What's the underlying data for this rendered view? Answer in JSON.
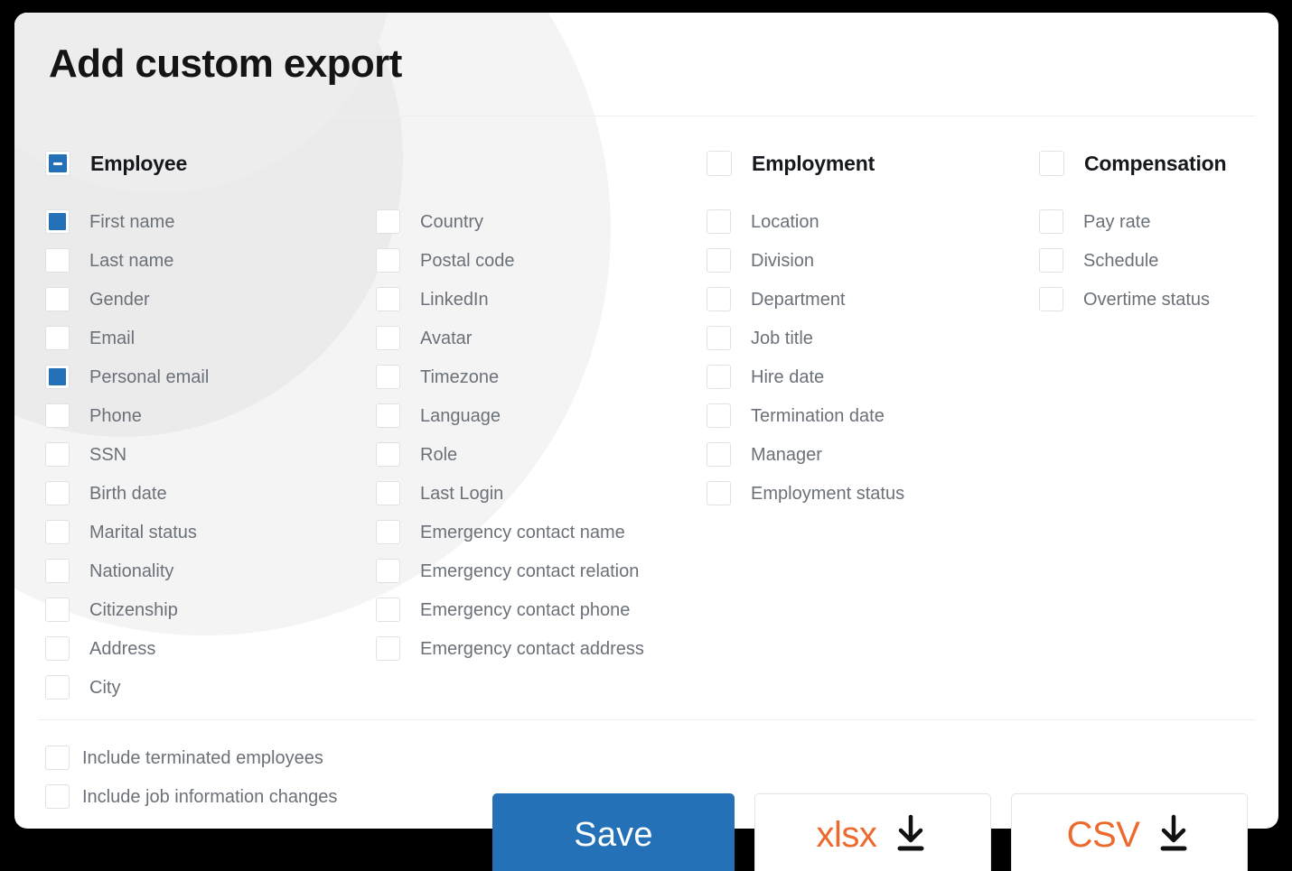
{
  "header": {
    "title": "Add custom export"
  },
  "colors": {
    "accent_blue": "#2471b8",
    "accent_orange": "#ec6a2e",
    "card_background": "#ffffff",
    "page_background": "#000000",
    "label_text": "#6b7179",
    "heading_text": "#15181c",
    "checkbox_border": "#dfe2e5",
    "divider": "#eceef0"
  },
  "groups": {
    "employee": {
      "label": "Employee",
      "state": "indeterminate"
    },
    "employment": {
      "label": "Employment",
      "state": "unchecked"
    },
    "compensation": {
      "label": "Compensation",
      "state": "unchecked"
    }
  },
  "columns": {
    "employee_col1": [
      {
        "label": "First name",
        "checked": true
      },
      {
        "label": "Last name",
        "checked": false
      },
      {
        "label": "Gender",
        "checked": false
      },
      {
        "label": "Email",
        "checked": false
      },
      {
        "label": "Personal email",
        "checked": true
      },
      {
        "label": "Phone",
        "checked": false
      },
      {
        "label": "SSN",
        "checked": false
      },
      {
        "label": "Birth date",
        "checked": false
      },
      {
        "label": "Marital status",
        "checked": false
      },
      {
        "label": "Nationality",
        "checked": false
      },
      {
        "label": "Citizenship",
        "checked": false
      },
      {
        "label": "Address",
        "checked": false
      },
      {
        "label": "City",
        "checked": false
      }
    ],
    "employee_col2": [
      {
        "label": "Country",
        "checked": false
      },
      {
        "label": "Postal code",
        "checked": false
      },
      {
        "label": "LinkedIn",
        "checked": false
      },
      {
        "label": "Avatar",
        "checked": false
      },
      {
        "label": "Timezone",
        "checked": false
      },
      {
        "label": "Language",
        "checked": false
      },
      {
        "label": "Role",
        "checked": false
      },
      {
        "label": "Last Login",
        "checked": false
      },
      {
        "label": "Emergency contact name",
        "checked": false
      },
      {
        "label": "Emergency contact relation",
        "checked": false
      },
      {
        "label": "Emergency contact phone",
        "checked": false
      },
      {
        "label": "Emergency contact address",
        "checked": false
      }
    ],
    "employment": [
      {
        "label": "Location",
        "checked": false
      },
      {
        "label": "Division",
        "checked": false
      },
      {
        "label": "Department",
        "checked": false
      },
      {
        "label": "Job title",
        "checked": false
      },
      {
        "label": "Hire date",
        "checked": false
      },
      {
        "label": "Termination date",
        "checked": false
      },
      {
        "label": "Manager",
        "checked": false
      },
      {
        "label": "Employment status",
        "checked": false
      }
    ],
    "compensation": [
      {
        "label": "Pay rate",
        "checked": false
      },
      {
        "label": "Schedule",
        "checked": false
      },
      {
        "label": "Overtime status",
        "checked": false
      }
    ]
  },
  "footer": {
    "options": [
      {
        "label": "Include terminated employees",
        "checked": false
      },
      {
        "label": "Include job information changes",
        "checked": false
      }
    ],
    "buttons": {
      "save": "Save",
      "xlsx": "xlsx",
      "csv": "CSV"
    },
    "icons": {
      "download": "download-icon"
    }
  }
}
